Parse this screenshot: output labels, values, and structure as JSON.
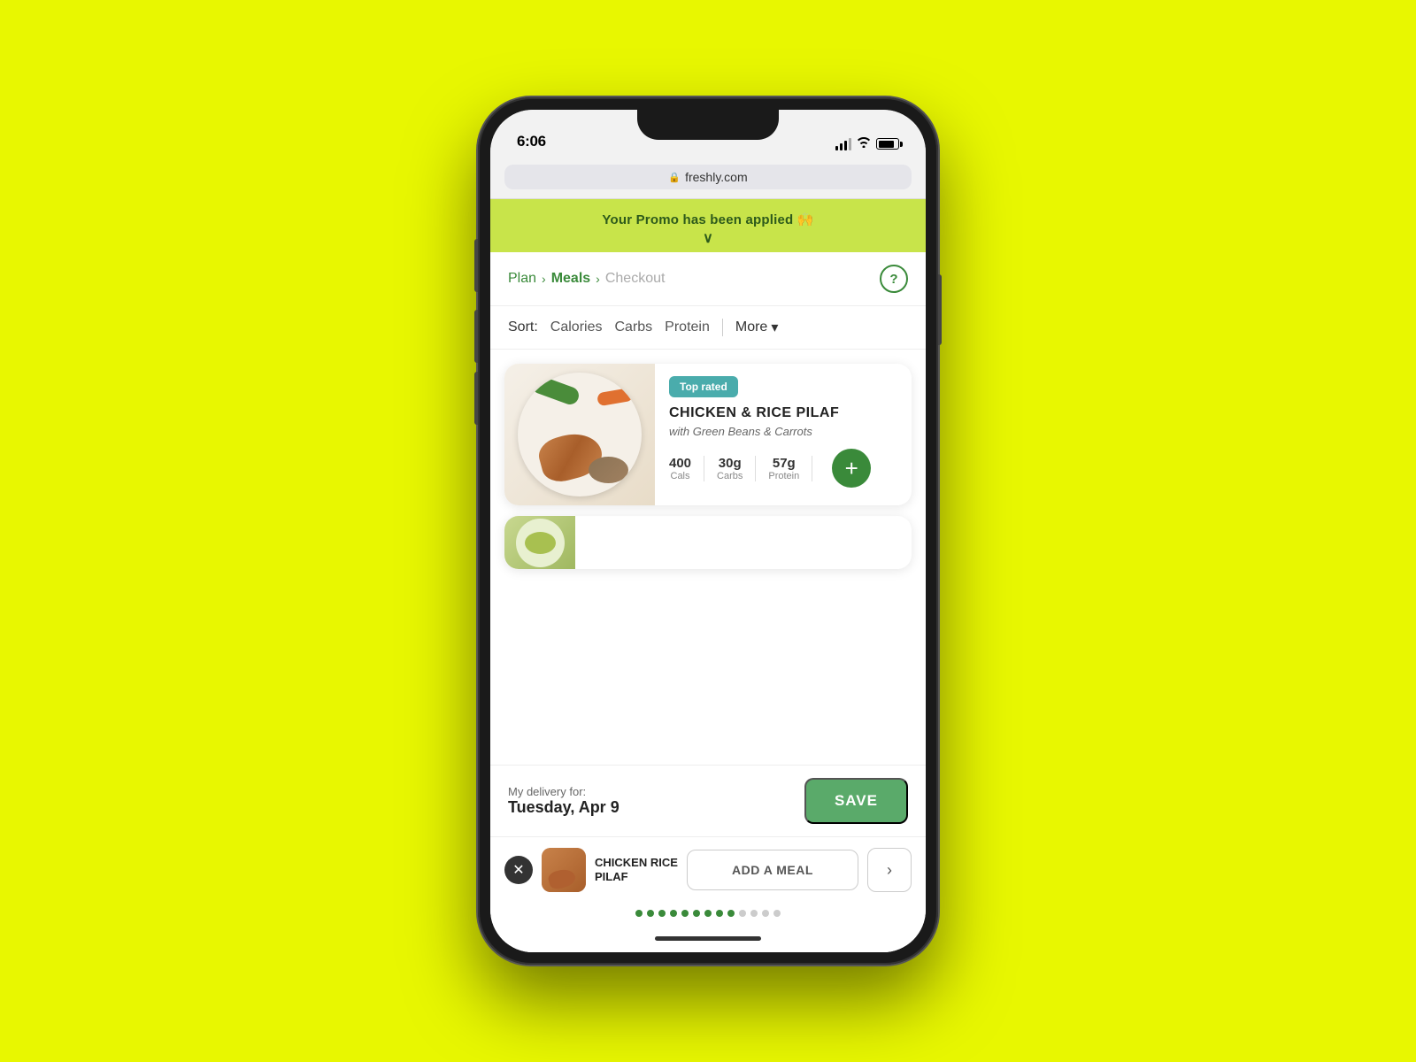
{
  "background": {
    "color": "#e8f700"
  },
  "status_bar": {
    "time": "6:06",
    "battery_pct": 85
  },
  "browser": {
    "url": "freshly.com",
    "lock_symbol": "🔒"
  },
  "promo_banner": {
    "text": "Your Promo has been applied 🙌",
    "chevron": "∨"
  },
  "breadcrumb": {
    "plan": "Plan",
    "separator1": ">",
    "meals": "Meals",
    "separator2": ">",
    "checkout": "Checkout",
    "help_symbol": "?"
  },
  "sort_bar": {
    "label": "Sort:",
    "options": [
      "Calories",
      "Carbs",
      "Protein"
    ],
    "more_label": "More"
  },
  "meal_card": {
    "badge": "Top rated",
    "name": "CHICKEN & RICE PILAF",
    "subtitle": "with Green Beans & Carrots",
    "calories_value": "400",
    "calories_label": "Cals",
    "carbs_value": "30g",
    "carbs_label": "Carbs",
    "protein_value": "57g",
    "protein_label": "Protein",
    "add_symbol": "+"
  },
  "delivery": {
    "label": "My delivery for:",
    "date": "Tuesday, Apr 9",
    "save_label": "SAVE"
  },
  "cart": {
    "close_symbol": "✕",
    "item_name": "CHICKEN RICE\nPILAF",
    "add_meal_label": "ADD A MEAL"
  },
  "dots": {
    "active_count": 9,
    "inactive_count": 4
  },
  "colors": {
    "green_accent": "#3a8a3a",
    "teal_badge": "#4aacac",
    "promo_bg": "#c8e44a",
    "save_btn": "#5aaa6a"
  }
}
